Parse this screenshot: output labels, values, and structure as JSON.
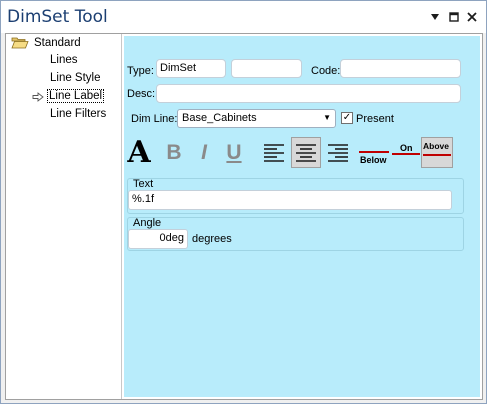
{
  "window": {
    "title": "DimSet Tool",
    "menu_icon": "dropdown-triangle-icon",
    "maximize_icon": "maximize-icon",
    "close_icon": "close-icon"
  },
  "tree": {
    "root": {
      "label": "Standard",
      "icon": "folder-open-icon"
    },
    "items": [
      {
        "label": "Lines"
      },
      {
        "label": "Line Style"
      },
      {
        "label": "Line Label",
        "selected": true,
        "marker_icon": "arrow-right-icon"
      },
      {
        "label": "Line Filters"
      }
    ]
  },
  "form": {
    "type_label": "Type:",
    "type_value": "DimSet",
    "type_extra_value": "",
    "code_label": "Code:",
    "code_value": "",
    "desc_label": "Desc:",
    "desc_value": "",
    "dimline_label": "Dim Line:",
    "dimline_value": "Base_Cabinets",
    "present_label": "Present",
    "present_checked": true,
    "format_buttons": [
      {
        "name": "font-icon",
        "glyph": "A"
      },
      {
        "name": "bold-icon",
        "glyph": "B"
      },
      {
        "name": "italic-icon",
        "glyph": "I"
      },
      {
        "name": "underline-icon",
        "glyph": "U"
      },
      {
        "name": "align-left-icon"
      },
      {
        "name": "align-center-icon",
        "pressed": true
      },
      {
        "name": "align-right-icon"
      },
      {
        "name": "label-below-icon",
        "text": "Below"
      },
      {
        "name": "label-on-icon",
        "text": "On"
      },
      {
        "name": "label-above-icon",
        "text": "Above",
        "pressed": true
      }
    ],
    "text_group_title": "Text",
    "text_value": "%.1f",
    "angle_group_title": "Angle",
    "angle_value": "0deg",
    "angle_units": "degrees"
  },
  "colors": {
    "panel_bg": "#b8ecfb",
    "title_color": "#1c3f72",
    "accent_red": "#c00000"
  }
}
